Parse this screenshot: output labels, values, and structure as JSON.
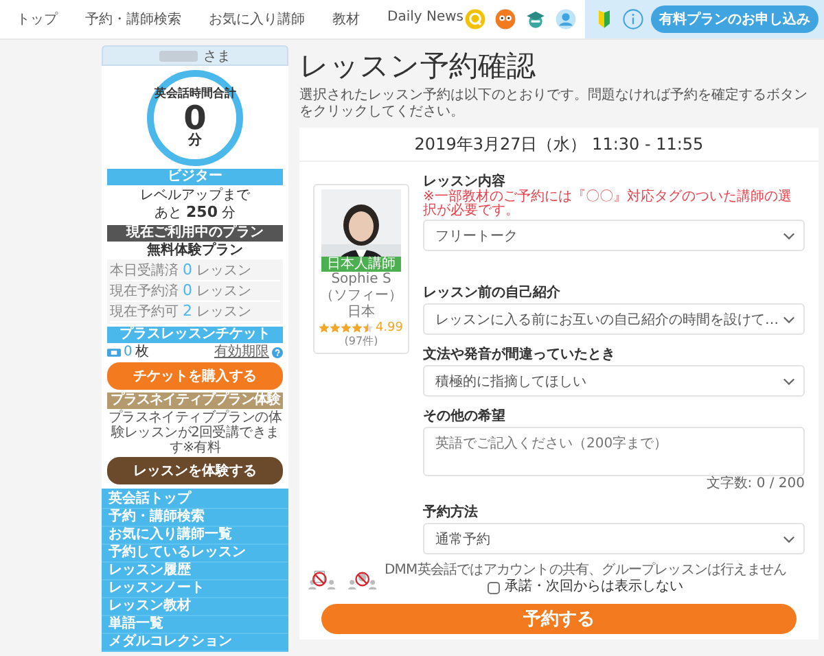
{
  "nav": {
    "items": [
      {
        "label": "トップ",
        "selected": false
      },
      {
        "label": "予約・講師検索",
        "selected": false
      },
      {
        "label": "お気に入り講師",
        "selected": false
      },
      {
        "label": "教材",
        "selected": false
      },
      {
        "label": "Daily News",
        "selected": false
      }
    ],
    "cta": "有料プランのお申し込み"
  },
  "sidebar": {
    "user_suffix": "さま",
    "total_label": "英会話時間合計",
    "total_value": "0",
    "total_unit": "分",
    "level": "ビジター",
    "levelup_label": "レベルアップまで",
    "levelup_prefix": "あと",
    "levelup_value": "250",
    "levelup_unit": "分",
    "plan_header": "現在ご利用中のプラン",
    "plan_name": "無料体験プラン",
    "stats": [
      {
        "label": "本日受講済",
        "value": "0",
        "unit": "レッスン"
      },
      {
        "label": "現在予約済",
        "value": "0",
        "unit": "レッスン"
      },
      {
        "label": "現在予約可",
        "value": "2",
        "unit": "レッスン"
      }
    ],
    "ticket_header": "プラスレッスンチケット",
    "ticket_count": "0",
    "ticket_unit": "枚",
    "ticket_expiry": "有効期限",
    "ticket_button": "チケットを購入する",
    "native_header": "プラスネイティブプラン体験",
    "native_text": "プラスネイティブプランの体験レッスンが2回受講できます",
    "native_note": "※有料",
    "native_button": "レッスンを体験する",
    "menu": [
      {
        "label": "英会話トップ",
        "selected": false
      },
      {
        "label": "予約・講師検索",
        "selected": false
      },
      {
        "label": "お気に入り講師一覧",
        "selected": false
      },
      {
        "label": "予約しているレッスン",
        "selected": false
      },
      {
        "label": "レッスン履歴",
        "selected": false
      },
      {
        "label": "レッスンノート",
        "selected": false
      },
      {
        "label": "レッスン教材",
        "selected": false
      },
      {
        "label": "単語一覧",
        "selected": false
      },
      {
        "label": "メダルコレクション",
        "selected": false
      }
    ]
  },
  "page": {
    "title": "レッスン予約確認",
    "description": "選択されたレッスン予約は以下のとおりです。問題なければ予約を確定するボタンをクリックしてください。",
    "datetime": "2019年3月27日（水） 11:30 - 11:55"
  },
  "teacher": {
    "badge": "日本人講師",
    "name": "Sophie S",
    "reading": "（ソフィー）",
    "country": "日本",
    "stars": 4.5,
    "rating": "4.99",
    "reviews": "(97件)"
  },
  "form": {
    "fields": [
      {
        "kind": "select",
        "label": "レッスン内容",
        "note": "※一部教材のご予約には『〇〇』対応タグのついた講師の選択が必要です。",
        "value": "フリートーク"
      },
      {
        "kind": "select",
        "label": "レッスン前の自己紹介",
        "value": "レッスンに入る前にお互いの自己紹介の時間を設けて…"
      },
      {
        "kind": "select",
        "label": "文法や発音が間違っていたとき",
        "value": "積極的に指摘してほしい"
      },
      {
        "kind": "textarea",
        "label": "その他の希望",
        "placeholder": "英語でご記入ください（200字まで）",
        "counter": "文字数: 0 / 200"
      },
      {
        "kind": "select",
        "label": "予約方法",
        "value": "通常予約"
      }
    ]
  },
  "notice": {
    "text": "DMM英会話ではアカウントの共有、グループレッスンは行えません",
    "checkbox_label": "承諾・次回からは表示しない",
    "checked": false
  },
  "submit": "予約する"
}
